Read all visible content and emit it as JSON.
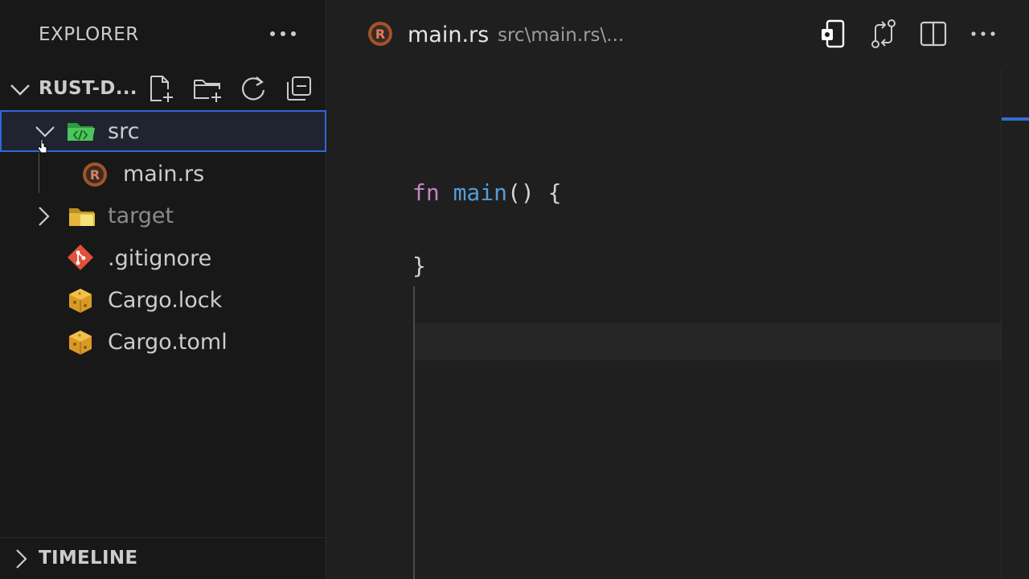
{
  "sidebar": {
    "title": "EXPLORER",
    "section_title": "RUST-D...",
    "tree": [
      {
        "label": "src",
        "type": "folder",
        "expanded": true,
        "selected": true,
        "icon": "src-folder-icon"
      },
      {
        "label": "main.rs",
        "type": "file",
        "icon": "rust-file-icon"
      },
      {
        "label": "target",
        "type": "folder",
        "expanded": false,
        "dimmed": true,
        "icon": "folder-icon"
      },
      {
        "label": ".gitignore",
        "type": "file",
        "icon": "git-icon"
      },
      {
        "label": "Cargo.lock",
        "type": "file",
        "icon": "cargo-icon"
      },
      {
        "label": "Cargo.toml",
        "type": "file",
        "icon": "cargo-icon"
      }
    ],
    "timeline_title": "TIMELINE"
  },
  "editor": {
    "tab": {
      "title": "main.rs",
      "path": "src\\main.rs\\..."
    },
    "code": {
      "line1_kw": "fn",
      "line1_name": "main",
      "line1_rest": "() {",
      "line2": "}"
    }
  },
  "colors": {
    "accent": "#2f68d8",
    "keyword": "#c586c0",
    "function": "#569cd6"
  }
}
